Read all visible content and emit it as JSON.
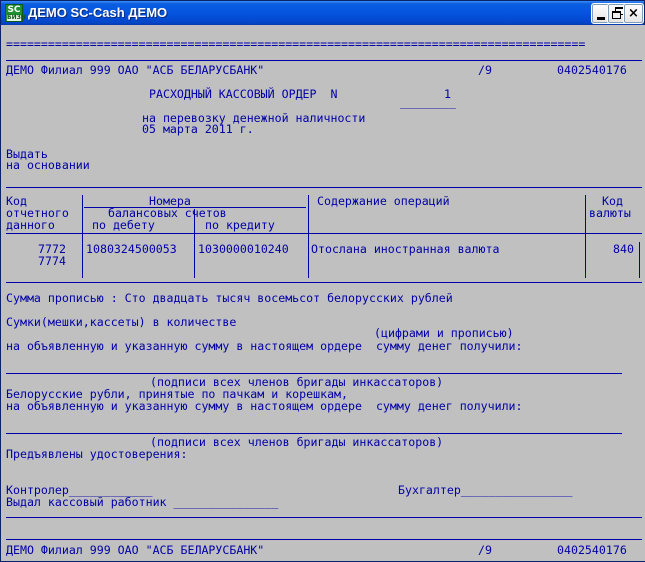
{
  "window": {
    "title": "ДЕМО SC-Cash ДЕМО",
    "icon_label_top": "SC",
    "icon_label_bottom": "БИЗН",
    "buttons": {
      "minimize": "minimize",
      "maximize": "restore",
      "close": "×"
    }
  },
  "document": {
    "separator_top": "===================================================================================",
    "header_left": "ДЕМО Филиал 999 ОАО \"АСБ БЕЛАРУСБАНК\"",
    "header_mid": "/9",
    "header_right": "0402540176",
    "order_title": "РАСХОДНЫЙ КАССОВЫЙ ОРДЕР  N",
    "order_number": "1",
    "order_number_line": "________",
    "purpose": "на перевозку денежной наличности",
    "date": "05 марта 2011 г.",
    "issue_label": "Выдать",
    "basis_label": "на основании",
    "table": {
      "headers": {
        "code_line1": "Код",
        "code_line2": "отчетного",
        "code_line3": "данного",
        "numbers_line1": "Номера",
        "numbers_line2": "балансовых счетов",
        "debit": "по дебету",
        "credit": "по кредиту",
        "content": "Содержание операций",
        "currency_code_line1": "Код",
        "currency_code_line2": "валюты"
      },
      "rows": [
        {
          "code": "7772",
          "debit": "1080324500053",
          "credit": "1030000010240",
          "content": "Отослана иностранная валюта",
          "currency": "840"
        },
        {
          "code": "7774",
          "debit": "",
          "credit": "",
          "content": "",
          "currency": ""
        }
      ]
    },
    "amount_in_words": "Сумма прописью : Сто двадцать тысяч восемьсот белорусских рублей",
    "bags_line": "Сумки(мешки,кассеты) в количестве",
    "digits_words_hint": "(цифрами и прописью)",
    "received_line": "на объявленную и указанную сумму в настоящем ордере  сумму денег получили:",
    "signatures_hint": "(подписи всех членов бригады инкассаторов)",
    "rubles_line1": "Белорусские рубли, принятые по пачкам и корешкам,",
    "rubles_line2": "на объявленную и указанную сумму в настоящем ордере  сумму денег получили:",
    "signatures_hint2": "(подписи всех членов бригады инкассаторов)",
    "ids_presented": "Предъявлены удостоверения:",
    "controller": "Контролер____________",
    "accountant": "Бухгалтер________________",
    "cashier": "Выдал кассовый работник _______________",
    "footer_left": "ДЕМО Филиал 999 ОАО \"АСБ БЕЛАРУСБАНК\"",
    "footer_mid": "/9",
    "footer_right": "0402540176"
  },
  "colors": {
    "text": "#0000a8",
    "background": "#c0c0c0",
    "titlebar": "#0554e0"
  }
}
